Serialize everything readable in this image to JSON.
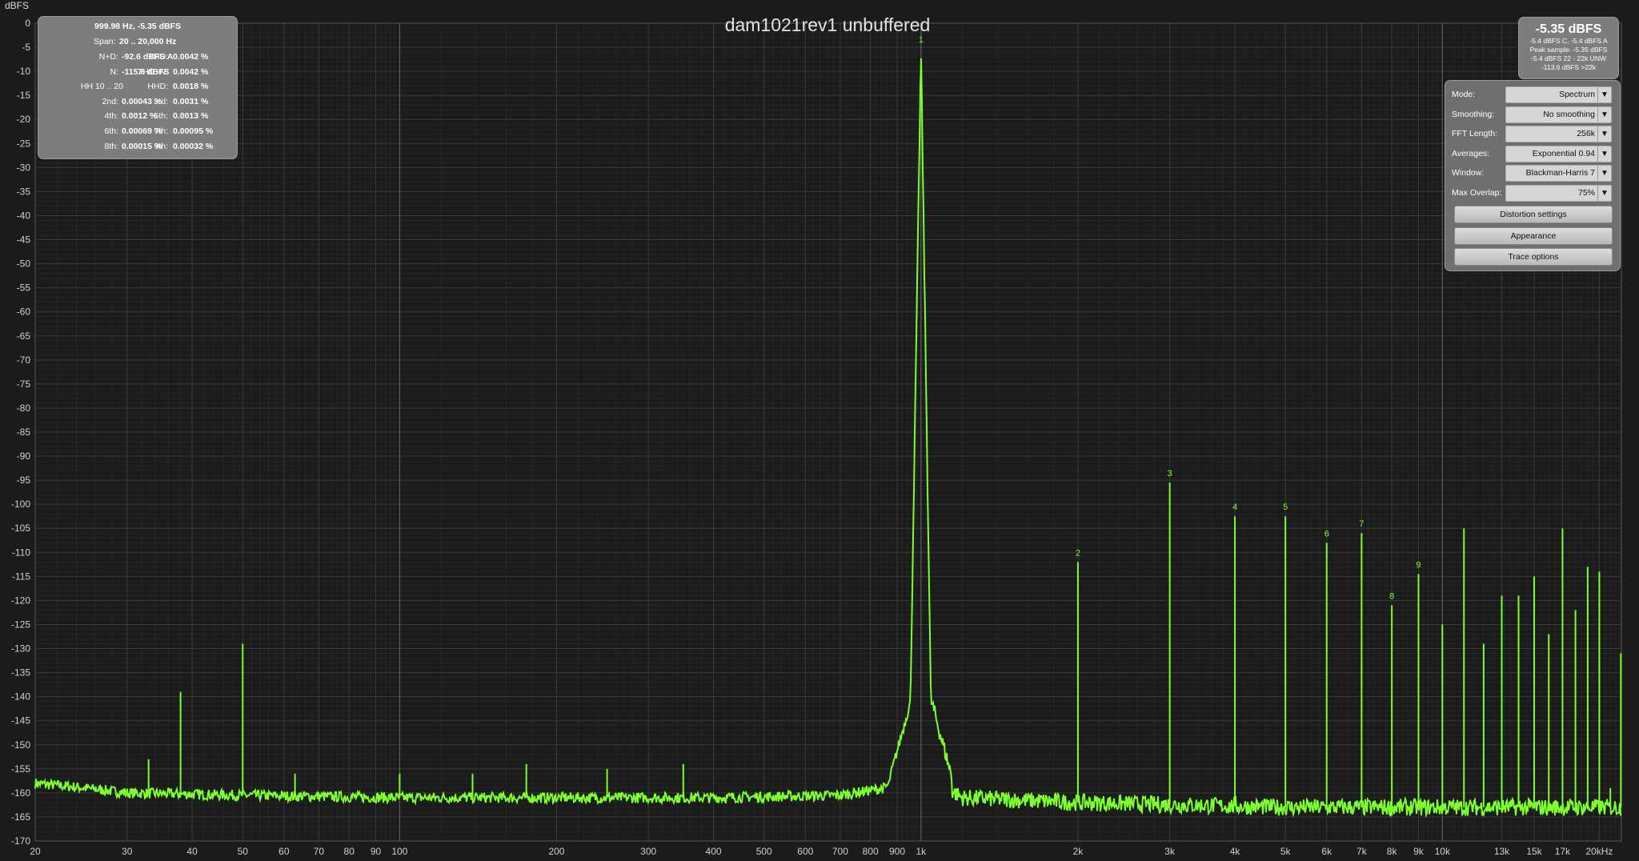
{
  "window": {
    "title": "dam1021rev1 unbuffered"
  },
  "stats_panel": {
    "header": "999.98 Hz, -5.35 dBFS",
    "span_label": "Span:",
    "span_value": "20 .. 20,000 Hz",
    "rows": [
      {
        "l_label": "N+D:",
        "l_value": "-92.6 dBFS A",
        "r_label": "THD:",
        "r_value": "0.0042 %"
      },
      {
        "l_label": "N:",
        "l_value": "-115.6 dBFS",
        "r_label": "THD+N:",
        "r_value": "0.0042 %"
      },
      {
        "l_label": "HH 10 .. 20",
        "l_value": "",
        "r_label": "HHD:",
        "r_value": "0.0018 %"
      },
      {
        "l_label": "2nd:",
        "l_value": "0.00043 %",
        "r_label": "3rd:",
        "r_value": "0.0031 %"
      },
      {
        "l_label": "4th:",
        "l_value": "0.0012 %",
        "r_label": "5th:",
        "r_value": "0.0013 %"
      },
      {
        "l_label": "6th:",
        "l_value": "0.00069 %",
        "r_label": "7th:",
        "r_value": "0.00095 %"
      },
      {
        "l_label": "8th:",
        "l_value": "0.00015 %",
        "r_label": "9th:",
        "r_value": "0.00032 %"
      }
    ]
  },
  "level_panel": {
    "value": "-5.35 dBFS",
    "lines": [
      "-5.4 dBFS C, -5.4 dBFS A",
      "Peak sample: -5.35 dBFS",
      "-5.4 dBFS 22 - 22k UNW",
      "-113.6 dBFS >22k"
    ]
  },
  "settings": {
    "rows": [
      {
        "label": "Mode:",
        "value": "Spectrum"
      },
      {
        "label": "Smoothing:",
        "value": "No  smoothing"
      },
      {
        "label": "FFT Length:",
        "value": "256k"
      },
      {
        "label": "Averages:",
        "value": "Exponential 0.94"
      },
      {
        "label": "Window:",
        "value": "Blackman-Harris 7"
      },
      {
        "label": "Max Overlap:",
        "value": "75%"
      }
    ],
    "buttons": [
      "Distortion settings",
      "Appearance",
      "Trace options"
    ],
    "dropdown_icon": "triangle-down-icon"
  },
  "chart_data": {
    "type": "line",
    "title": "dam1021rev1 unbuffered",
    "ylabel": "dBFS",
    "xlabel": "",
    "x_scale": "log",
    "xlim": [
      20,
      22050
    ],
    "ylim": [
      -170,
      0
    ],
    "grid": true,
    "colors": {
      "trace": "#7dff2d",
      "background": "#1b1b1b",
      "grid": "#3a3a3a",
      "grid_minor": "#2a2a2a"
    },
    "x_tick_labels": [
      {
        "v": 20,
        "t": "20"
      },
      {
        "v": 30,
        "t": "30"
      },
      {
        "v": 40,
        "t": "40"
      },
      {
        "v": 50,
        "t": "50"
      },
      {
        "v": 60,
        "t": "60"
      },
      {
        "v": 70,
        "t": "70"
      },
      {
        "v": 80,
        "t": "80"
      },
      {
        "v": 90,
        "t": "90"
      },
      {
        "v": 100,
        "t": "100"
      },
      {
        "v": 200,
        "t": "200"
      },
      {
        "v": 300,
        "t": "300"
      },
      {
        "v": 400,
        "t": "400"
      },
      {
        "v": 500,
        "t": "500"
      },
      {
        "v": 600,
        "t": "600"
      },
      {
        "v": 700,
        "t": "700"
      },
      {
        "v": 800,
        "t": "800"
      },
      {
        "v": 900,
        "t": "900"
      },
      {
        "v": 1000,
        "t": "1k"
      },
      {
        "v": 2000,
        "t": "2k"
      },
      {
        "v": 3000,
        "t": "3k"
      },
      {
        "v": 4000,
        "t": "4k"
      },
      {
        "v": 5000,
        "t": "5k"
      },
      {
        "v": 6000,
        "t": "6k"
      },
      {
        "v": 7000,
        "t": "7k"
      },
      {
        "v": 8000,
        "t": "8k"
      },
      {
        "v": 9000,
        "t": "9k"
      },
      {
        "v": 10000,
        "t": "10k"
      },
      {
        "v": 13000,
        "t": "13k"
      },
      {
        "v": 15000,
        "t": "15k"
      },
      {
        "v": 17000,
        "t": "17k"
      },
      {
        "v": 20000,
        "t": "20kHz"
      }
    ],
    "y_ticks": [
      0,
      -5,
      -10,
      -15,
      -20,
      -25,
      -30,
      -35,
      -40,
      -45,
      -50,
      -55,
      -60,
      -65,
      -70,
      -75,
      -80,
      -85,
      -90,
      -95,
      -100,
      -105,
      -110,
      -115,
      -120,
      -125,
      -130,
      -135,
      -140,
      -145,
      -150,
      -155,
      -160,
      -165,
      -170
    ],
    "noise_floor": [
      {
        "x": 20,
        "y": -158
      },
      {
        "x": 25,
        "y": -159
      },
      {
        "x": 30,
        "y": -160
      },
      {
        "x": 50,
        "y": -160.5
      },
      {
        "x": 100,
        "y": -161
      },
      {
        "x": 200,
        "y": -161
      },
      {
        "x": 400,
        "y": -161
      },
      {
        "x": 700,
        "y": -160.5
      },
      {
        "x": 850,
        "y": -159
      },
      {
        "x": 950,
        "y": -155
      },
      {
        "x": 1000,
        "y": -5.35
      },
      {
        "x": 1050,
        "y": -157
      },
      {
        "x": 1200,
        "y": -161
      },
      {
        "x": 2000,
        "y": -162
      },
      {
        "x": 5000,
        "y": -163
      },
      {
        "x": 10000,
        "y": -163
      },
      {
        "x": 22050,
        "y": -163
      }
    ],
    "peaks": [
      {
        "x": 33,
        "y": -153
      },
      {
        "x": 38,
        "y": -139
      },
      {
        "x": 50,
        "y": -129
      },
      {
        "x": 63,
        "y": -156
      },
      {
        "x": 100,
        "y": -156
      },
      {
        "x": 138,
        "y": -156
      },
      {
        "x": 175,
        "y": -154
      },
      {
        "x": 250,
        "y": -155
      },
      {
        "x": 350,
        "y": -154
      },
      {
        "x": 1000,
        "y": -5.35,
        "label": "1"
      },
      {
        "x": 2000,
        "y": -112,
        "label": "2"
      },
      {
        "x": 3000,
        "y": -95.5,
        "label": "3"
      },
      {
        "x": 4000,
        "y": -102.5,
        "label": "4"
      },
      {
        "x": 5000,
        "y": -102.5,
        "label": "5"
      },
      {
        "x": 6000,
        "y": -108,
        "label": "6"
      },
      {
        "x": 7000,
        "y": -106,
        "label": "7"
      },
      {
        "x": 8000,
        "y": -121,
        "label": "8"
      },
      {
        "x": 9000,
        "y": -114.5,
        "label": "9"
      },
      {
        "x": 10000,
        "y": -125
      },
      {
        "x": 11000,
        "y": -105
      },
      {
        "x": 12000,
        "y": -129
      },
      {
        "x": 13000,
        "y": -119
      },
      {
        "x": 14000,
        "y": -119
      },
      {
        "x": 15000,
        "y": -115
      },
      {
        "x": 16000,
        "y": -127
      },
      {
        "x": 17000,
        "y": -105
      },
      {
        "x": 18000,
        "y": -122
      },
      {
        "x": 19000,
        "y": -113
      },
      {
        "x": 20000,
        "y": -114
      },
      {
        "x": 21000,
        "y": -159
      },
      {
        "x": 22000,
        "y": -131
      }
    ]
  }
}
